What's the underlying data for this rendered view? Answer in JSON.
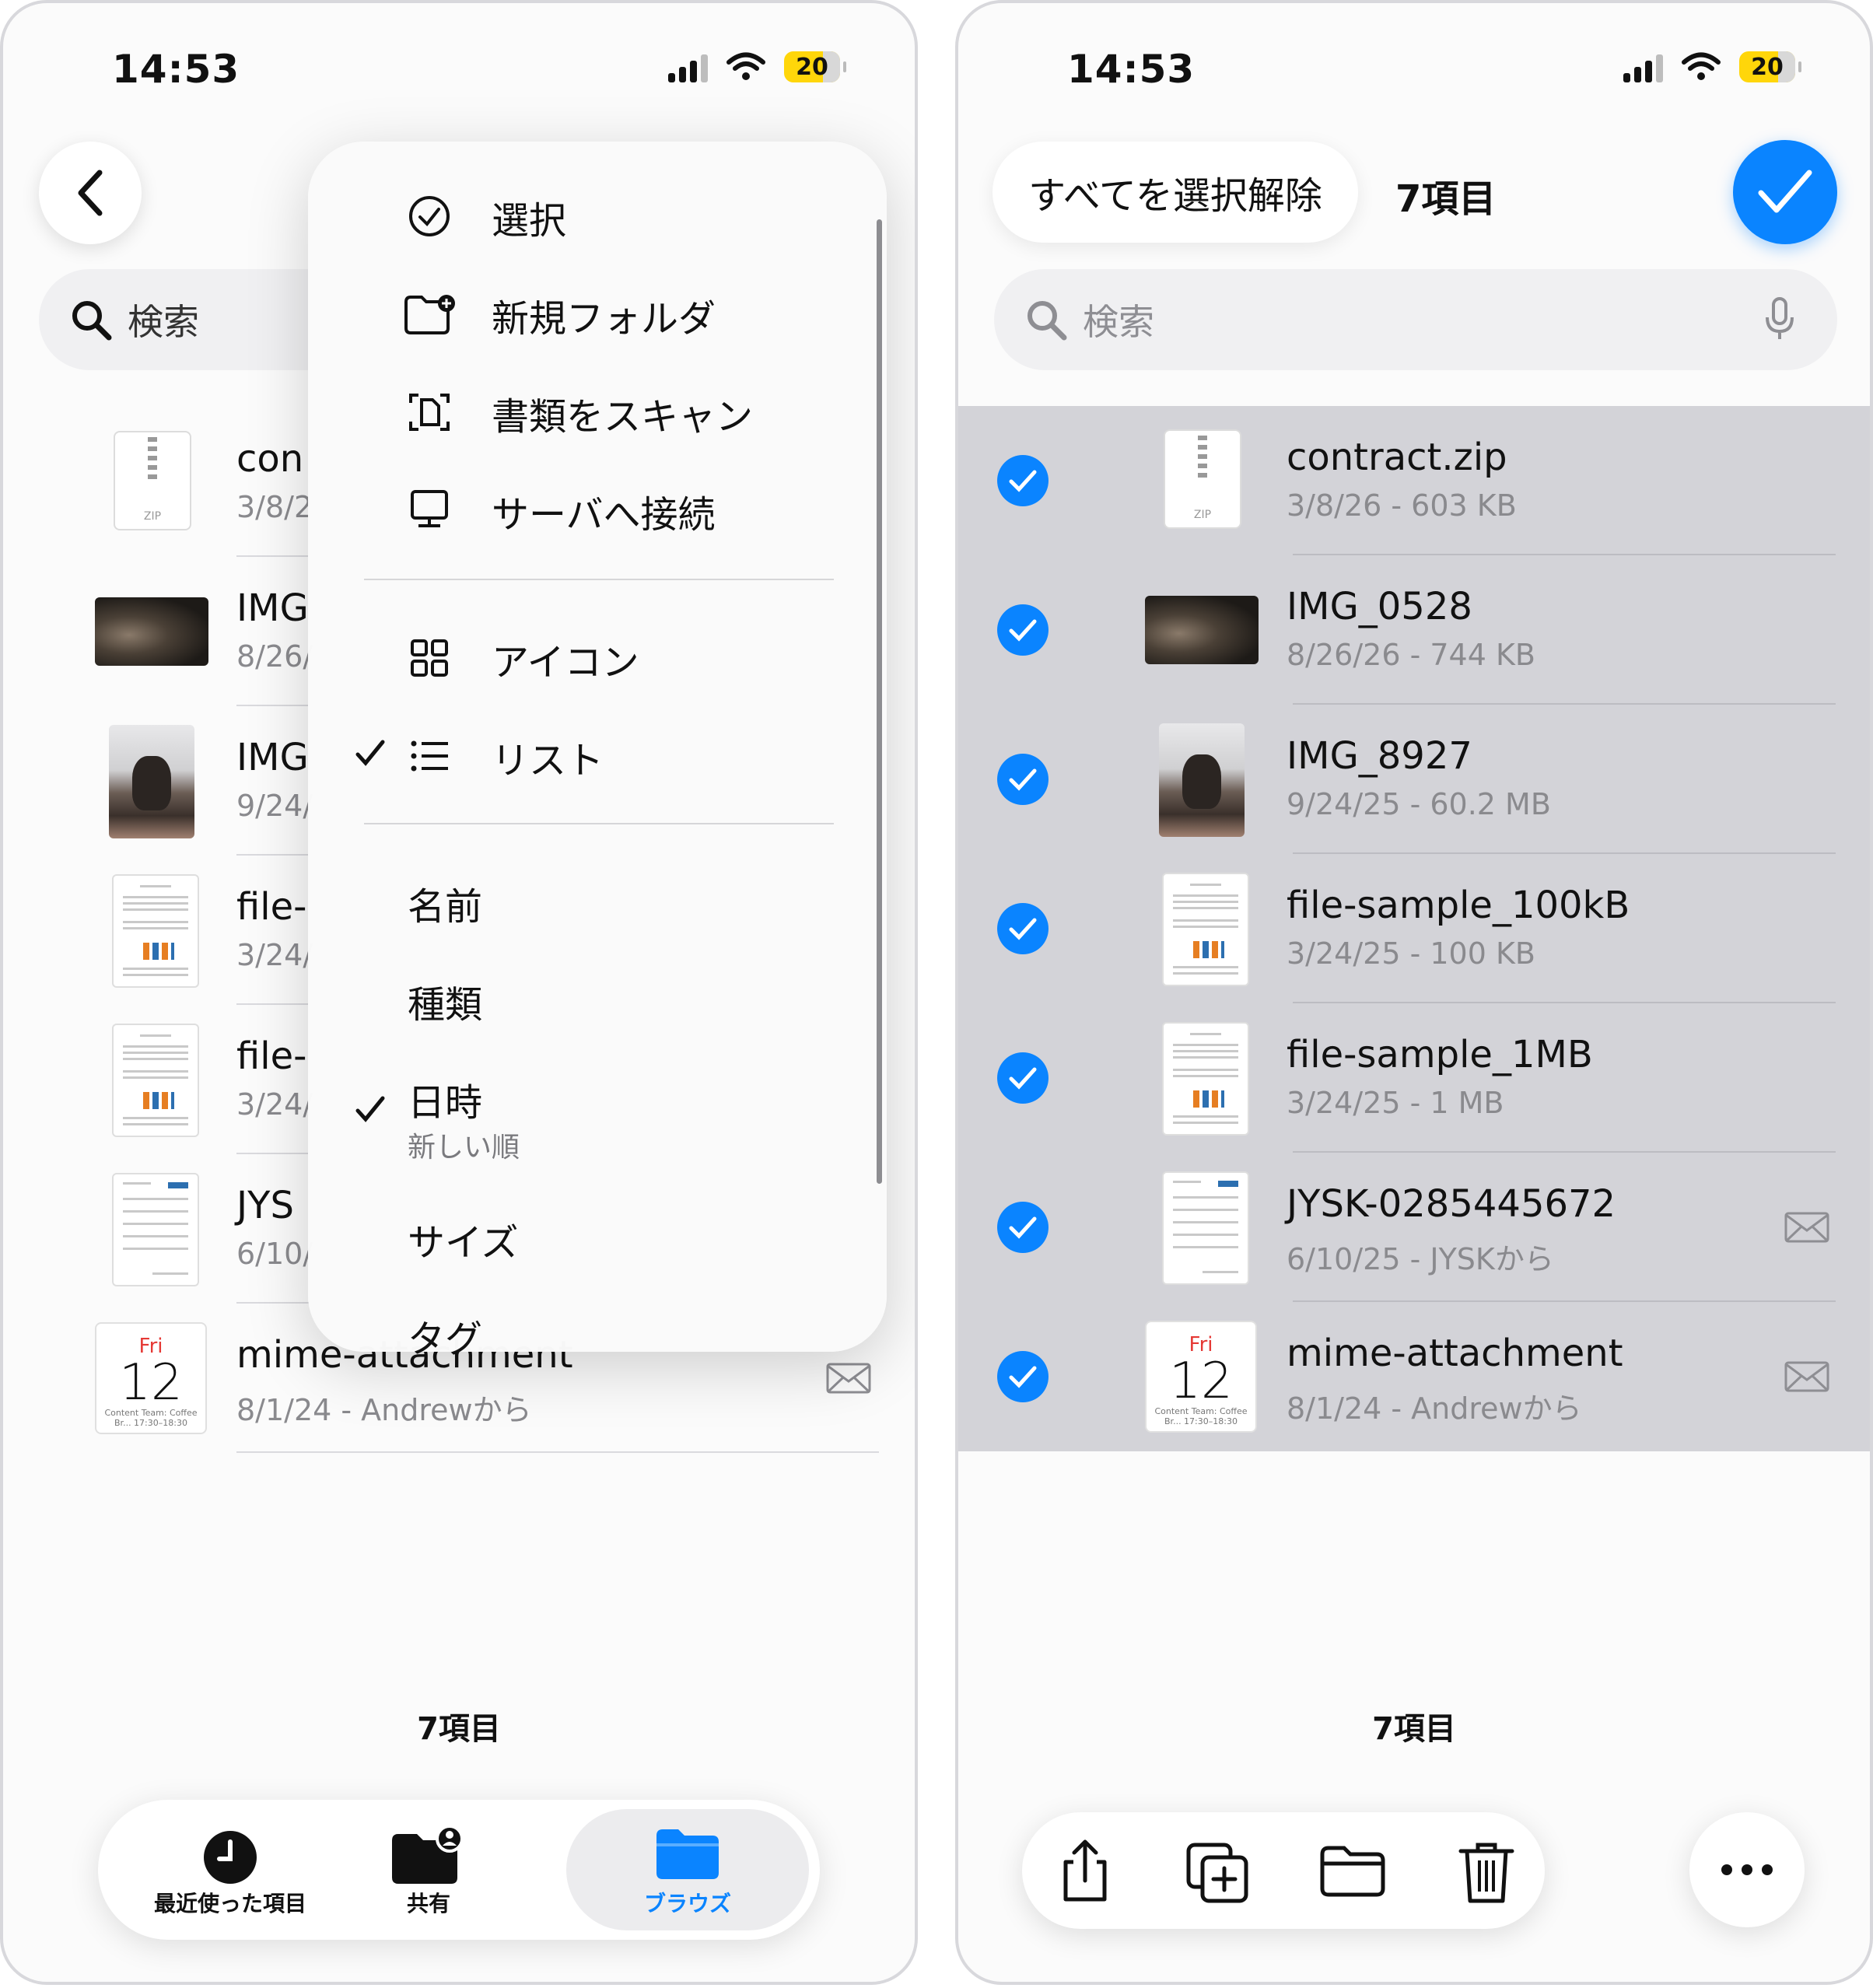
{
  "status": {
    "time": "14:53",
    "battery": "20"
  },
  "left": {
    "search_placeholder": "検索",
    "files": [
      {
        "name": "con",
        "meta": "3/8/2"
      },
      {
        "name": "IMG",
        "meta": "8/26/"
      },
      {
        "name": "IMG",
        "meta": "9/24/"
      },
      {
        "name": "file-",
        "meta": "3/24/"
      },
      {
        "name": "file-",
        "meta": "3/24/"
      },
      {
        "name": "JYS",
        "meta": "6/10/"
      },
      {
        "name": "mime-attachment",
        "meta": "8/1/24 - Andrewから"
      }
    ],
    "count": "7項目",
    "menu": {
      "actions": [
        "選択",
        "新規フォルダ",
        "書類をスキャン",
        "サーバへ接続"
      ],
      "views": [
        "アイコン",
        "リスト"
      ],
      "sort": [
        "名前",
        "種類",
        "日時",
        "サイズ",
        "タグ"
      ],
      "sort_sub": "新しい順"
    },
    "tabs": [
      "最近使った項目",
      "共有",
      "ブラウズ"
    ]
  },
  "right": {
    "deselect_all": "すべてを選択解除",
    "selected_count": "7項目",
    "search_placeholder": "検索",
    "files": [
      {
        "name": "contract.zip",
        "meta": "3/8/26 - 603 KB"
      },
      {
        "name": "IMG_0528",
        "meta": "8/26/26 - 744 KB"
      },
      {
        "name": "IMG_8927",
        "meta": "9/24/25 - 60.2 MB"
      },
      {
        "name": "file-sample_100kB",
        "meta": "3/24/25 - 100 KB"
      },
      {
        "name": "file-sample_1MB",
        "meta": "3/24/25 - 1 MB"
      },
      {
        "name": "JYSK-0285445672",
        "meta": "6/10/25 - JYSKから"
      },
      {
        "name": "mime-attachment",
        "meta": "8/1/24 - Andrewから"
      }
    ],
    "count": "7項目"
  },
  "calendar": {
    "day": "Fri",
    "date": "12",
    "caption": "Content Team: Coffee Br... 17:30–18:30"
  },
  "zip_label": "ZIP",
  "colors": {
    "accent": "#0a84ff",
    "selection_bg": "#d3d3d8",
    "battery": "#ffd60a"
  }
}
